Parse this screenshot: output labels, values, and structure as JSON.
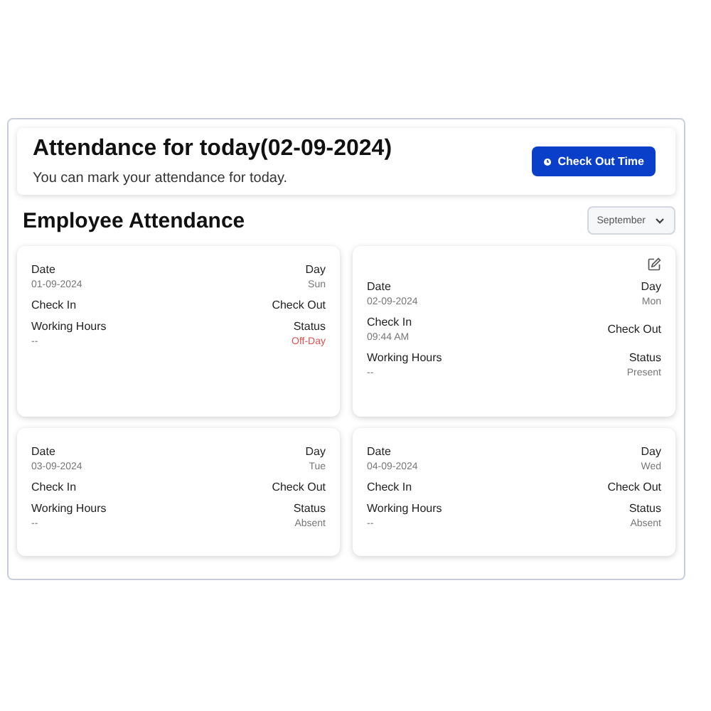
{
  "today": {
    "title": "Attendance for today(02-09-2024)",
    "subtitle": "You can mark your attendance for today.",
    "button": "Check Out Time"
  },
  "section_title": "Employee Attendance",
  "month_select": {
    "value": "September"
  },
  "cards": [
    {
      "date_label": "Date",
      "date": "01-09-2024",
      "day_label": "Day",
      "day": "Sun",
      "check_in_label": "Check In",
      "check_out_label": "Check Out",
      "working_hours_label": "Working Hours",
      "working_hours": "--",
      "status_label": "Status",
      "status": "Off-Day",
      "color": "#e05252",
      "editable": false
    },
    {
      "date_label": "Date",
      "date": "02-09-2024",
      "day_label": "Day",
      "day": "Mon",
      "check_in_label": "Check In",
      "check_in": "09:44 AM",
      "check_out_label": "Check Out",
      "working_hours_label": "Working Hours",
      "working_hours": "--",
      "status_label": "Status",
      "status": "Present",
      "color": "#777777",
      "editable": true
    },
    {
      "date_label": "Date",
      "date": "03-09-2024",
      "day_label": "Day",
      "day": "Tue",
      "check_in_label": "Check In",
      "check_out_label": "Check Out",
      "working_hours_label": "Working Hours",
      "working_hours": "--",
      "status_label": "Status",
      "status": "Absent",
      "color": "#777777",
      "editable": false
    },
    {
      "date_label": "Date",
      "date": "04-09-2024",
      "day_label": "Day",
      "day": "Wed",
      "check_in_label": "Check In",
      "check_out_label": "Check Out",
      "working_hours_label": "Working Hours",
      "working_hours": "--",
      "status_label": "Status",
      "status": "Absent",
      "color": "#777777",
      "editable": false
    }
  ]
}
